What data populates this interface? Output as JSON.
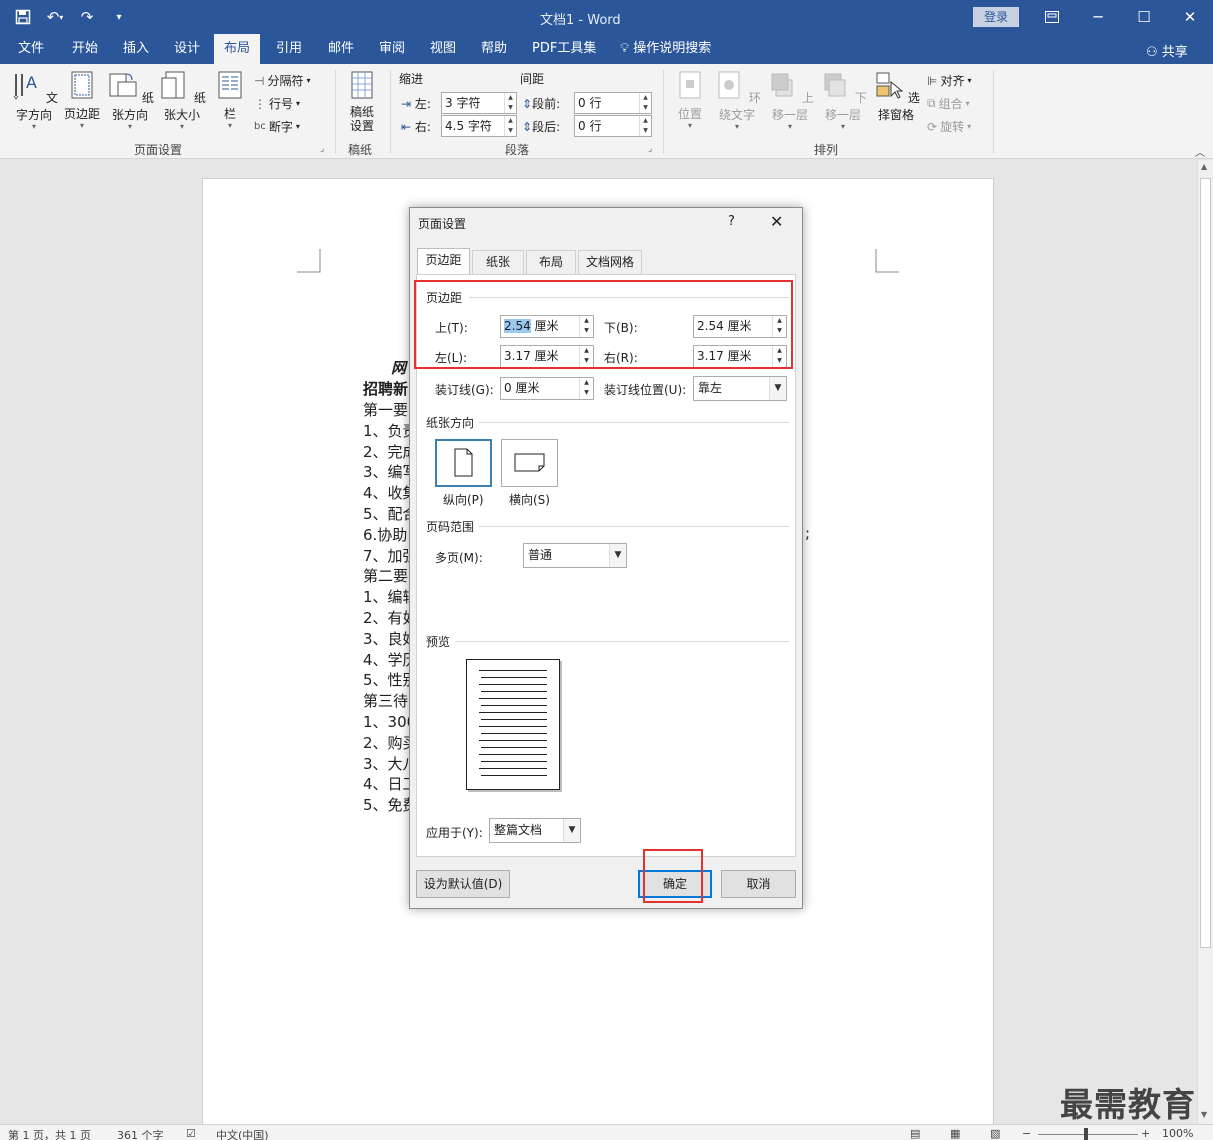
{
  "window": {
    "title": "文档1  -  Word",
    "login_label": "登录"
  },
  "tabs": [
    {
      "label": "文件"
    },
    {
      "label": "开始"
    },
    {
      "label": "插入"
    },
    {
      "label": "设计"
    },
    {
      "label": "布局"
    },
    {
      "label": "引用"
    },
    {
      "label": "邮件"
    },
    {
      "label": "审阅"
    },
    {
      "label": "视图"
    },
    {
      "label": "帮助"
    },
    {
      "label": "PDF工具集"
    },
    {
      "label": "操作说明搜索"
    }
  ],
  "share_label": "共享",
  "ribbon": {
    "page_setup": {
      "group_label": "页面设置",
      "text_direction": "文字方向",
      "margins": "页边距",
      "orientation": "纸张方向",
      "size": "纸张大小",
      "columns": "栏",
      "breaks": "分隔符",
      "line_numbers": "行号",
      "hyphenation": "断字"
    },
    "manuscript": {
      "group_label": "稿纸",
      "button": "稿纸设置"
    },
    "paragraph": {
      "group_label": "段落",
      "indent_header": "缩进",
      "spacing_header": "间距",
      "left_label": "左:",
      "left_value": "3 字符",
      "right_label": "右:",
      "right_value": "4.5 字符",
      "before_label": "段前:",
      "before_value": "0 行",
      "after_label": "段后:",
      "after_value": "0 行"
    },
    "arrange": {
      "group_label": "排列",
      "position": "位置",
      "wrap_text": "环绕文字",
      "bring_forward": "上移一层",
      "send_backward": "下移一层",
      "selection_pane": "选择窗格",
      "align": "对齐",
      "group": "组合",
      "rotate": "旋转"
    }
  },
  "document": {
    "lines": [
      {
        "text": "网"
      },
      {
        "text": "招聘新"
      },
      {
        "text": "第一要"
      },
      {
        "text": "1、负责"
      },
      {
        "text": "2、完成"
      },
      {
        "text": "3、编写"
      },
      {
        "text": "4、收集"
      },
      {
        "text": "5、配合"
      },
      {
        "text": "6.协助"
      },
      {
        "text": "7、加强"
      },
      {
        "text": "第二要"
      },
      {
        "text": "1、编辑"
      },
      {
        "text": "2、有如"
      },
      {
        "text": "3、良好"
      },
      {
        "text": "4、学历"
      },
      {
        "text": "5、性别"
      },
      {
        "text": "第三待"
      },
      {
        "text": "1、300"
      },
      {
        "text": "2、购买"
      },
      {
        "text": "3、大八"
      },
      {
        "text": "4、日工"
      },
      {
        "text": "5、免费"
      }
    ],
    "trailing_semicolon": ";"
  },
  "dialog": {
    "title": "页面设置",
    "help": "?",
    "tabs": [
      {
        "label": "页边距"
      },
      {
        "label": "纸张"
      },
      {
        "label": "布局"
      },
      {
        "label": "文档网格"
      }
    ],
    "margins_section": "页边距",
    "top_label": "上(T):",
    "top_value": "2.54",
    "top_unit": " 厘米",
    "bottom_label": "下(B):",
    "bottom_value": "2.54 厘米",
    "left_label": "左(L):",
    "left_value": "3.17 厘米",
    "right_label": "右(R):",
    "right_value": "3.17 厘米",
    "gutter_label": "装订线(G):",
    "gutter_value": "0 厘米",
    "gutter_pos_label": "装订线位置(U):",
    "gutter_pos_value": "靠左",
    "orientation_section": "纸张方向",
    "portrait_label": "纵向(P)",
    "landscape_label": "横向(S)",
    "pages_section": "页码范围",
    "multiple_pages_label": "多页(M):",
    "multiple_pages_value": "普通",
    "preview_section": "预览",
    "apply_to_label": "应用于(Y):",
    "apply_to_value": "整篇文档",
    "set_default": "设为默认值(D)",
    "ok": "确定",
    "cancel": "取消"
  },
  "status": {
    "page": "第 1 页，共 1 页",
    "words": "361 个字",
    "language": "中文(中国)",
    "zoom": "100%"
  },
  "watermark": "最需教育",
  "colors": {
    "brand": "#2b579a",
    "highlight": "#e5312f",
    "selection": "#99c9ef"
  }
}
